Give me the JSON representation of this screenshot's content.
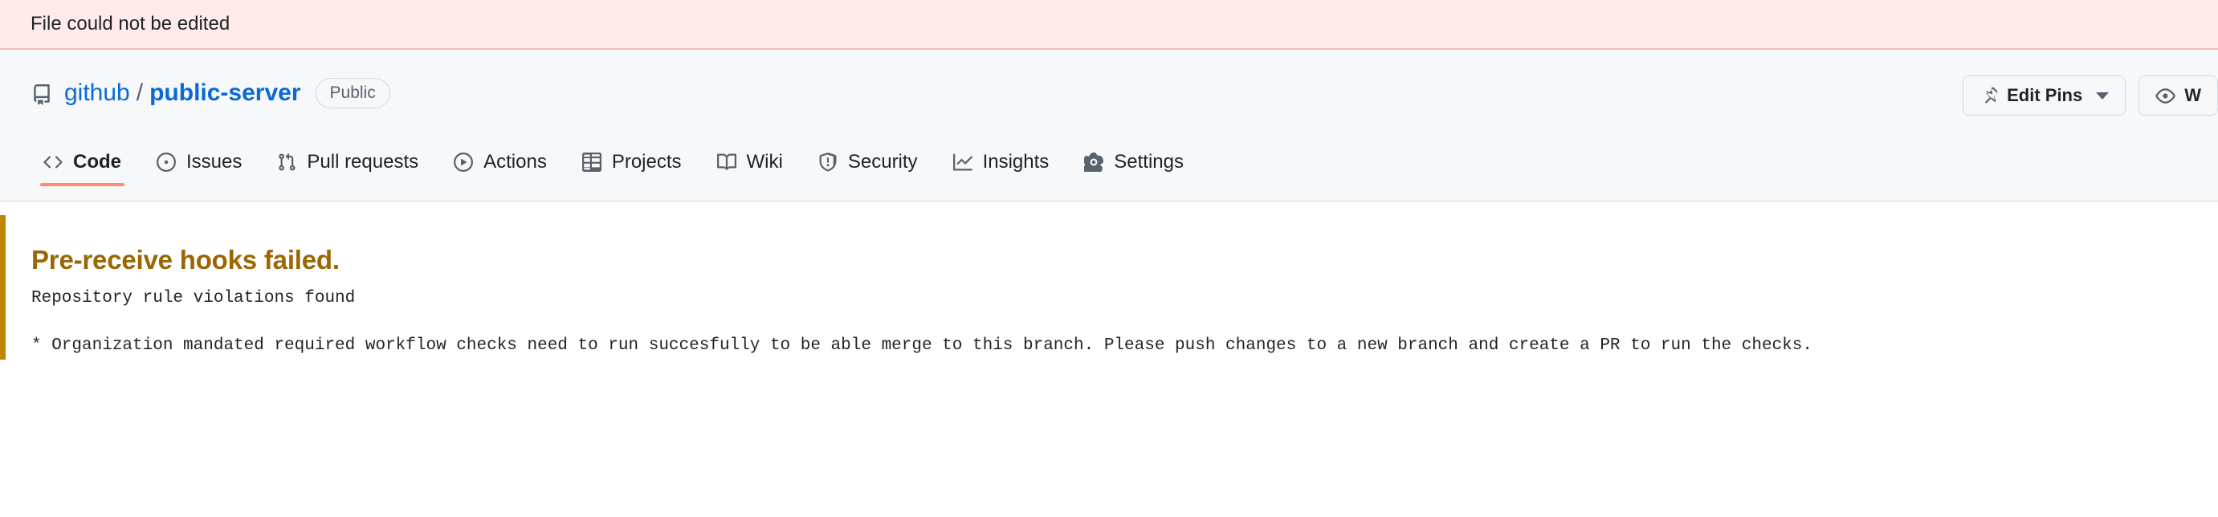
{
  "flash": {
    "message": "File could not be edited",
    "background_color": "#FFEBE9",
    "border_color": "#F5BCB7"
  },
  "repo_header": {
    "icon": "repo-icon",
    "owner": "github",
    "separator": "/",
    "name": "public-server",
    "visibility": "Public",
    "actions": [
      {
        "label": "Edit Pins",
        "icon": "pin-icon",
        "has_caret": true
      },
      {
        "label": "W",
        "icon": "eye-icon",
        "has_caret": false
      }
    ]
  },
  "nav": {
    "selected": "Code",
    "underline_color": "#FD8C73",
    "items": [
      {
        "label": "Code",
        "icon": "code-icon",
        "selected": true
      },
      {
        "label": "Issues",
        "icon": "issue-opened-icon",
        "selected": false
      },
      {
        "label": "Pull requests",
        "icon": "git-pull-request-icon",
        "selected": false
      },
      {
        "label": "Actions",
        "icon": "play-icon",
        "selected": false
      },
      {
        "label": "Projects",
        "icon": "table-icon",
        "selected": false
      },
      {
        "label": "Wiki",
        "icon": "book-icon",
        "selected": false
      },
      {
        "label": "Security",
        "icon": "shield-icon",
        "selected": false
      },
      {
        "label": "Insights",
        "icon": "graph-icon",
        "selected": false
      },
      {
        "label": "Settings",
        "icon": "gear-icon",
        "selected": false
      }
    ]
  },
  "error": {
    "accent_color": "#BF8700",
    "title_color": "#9A6700",
    "title": "Pre-receive hooks failed.",
    "line1": "Repository rule violations found",
    "line2": "* Organization mandated required workflow checks need to run succesfully to be able merge to this branch. Please push changes to a new branch and create a PR to run the checks."
  }
}
